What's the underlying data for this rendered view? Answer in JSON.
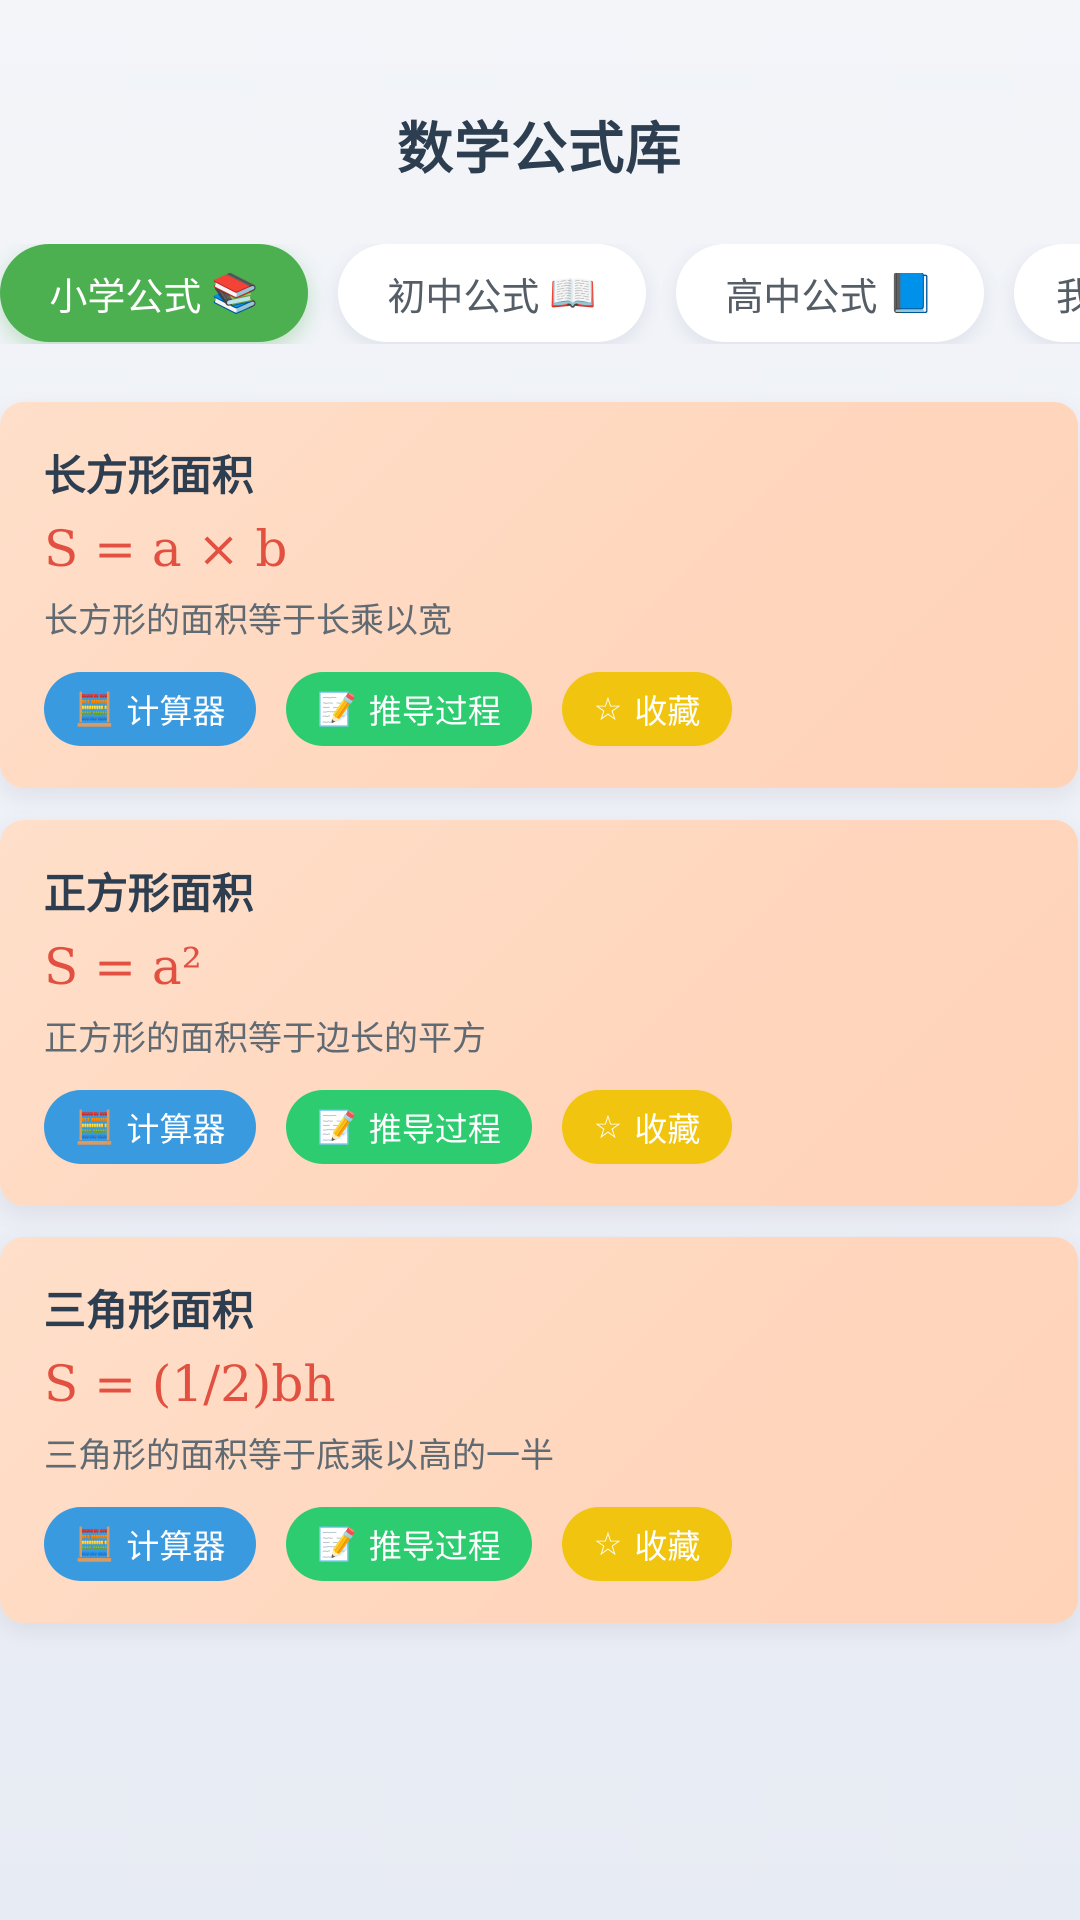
{
  "header": {
    "title": "数学公式库"
  },
  "tabs": [
    {
      "label": "小学公式",
      "emoji": "📚",
      "active": true
    },
    {
      "label": "初中公式",
      "emoji": "📖",
      "active": false
    },
    {
      "label": "高中公式",
      "emoji": "📘",
      "active": false
    },
    {
      "label": "我",
      "emoji": "",
      "active": false
    }
  ],
  "cards": [
    {
      "title": "长方形面积",
      "formula": "S = a × b",
      "description": "长方形的面积等于长乘以宽"
    },
    {
      "title": "正方形面积",
      "formula": "S = a²",
      "description": "正方形的面积等于边长的平方"
    },
    {
      "title": "三角形面积",
      "formula": "S = (1/2)bh",
      "description": "三角形的面积等于底乘以高的一半"
    }
  ],
  "actions": {
    "calculator": {
      "icon": "🧮",
      "label": "计算器"
    },
    "derivation": {
      "icon": "📝",
      "label": "推导过程"
    },
    "favorite": {
      "icon": "☆",
      "label": "收藏"
    }
  },
  "colors": {
    "active_tab": "#4caf50",
    "calculator_button": "#3a9ae0",
    "derivation_button": "#2ecc71",
    "favorite_button": "#f1c40f",
    "formula_text": "#e15040",
    "card_background": "#ffd8c0"
  }
}
